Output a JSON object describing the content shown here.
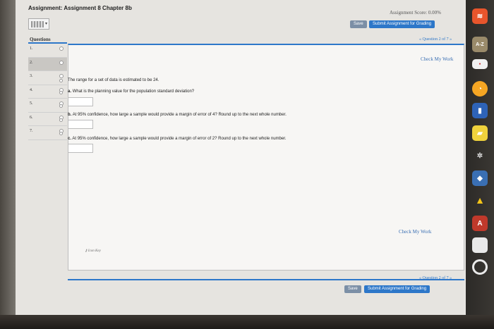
{
  "header": {
    "title": "Assignment: Assignment 8 Chapter 8b",
    "score": "Assignment Score: 0.00%"
  },
  "toolbar": {
    "save_label": "Save",
    "submit_label": "Submit Assignment for Grading"
  },
  "questions": {
    "header": "Questions",
    "items": [
      {
        "num": "1."
      },
      {
        "num": "2."
      },
      {
        "num": "3."
      },
      {
        "num": "4."
      },
      {
        "num": "5."
      },
      {
        "num": "6."
      },
      {
        "num": "7."
      }
    ],
    "active_index": 1
  },
  "nav": {
    "position": "« Question 2 of 7 »"
  },
  "main": {
    "check_work_label": "Check My Work",
    "intro": "The range for a set of data is estimated to be 24.",
    "parts": [
      {
        "label": "a.",
        "text": "What is the planning value for the population standard deviation?"
      },
      {
        "label": "b.",
        "text": "At 95% confidence, how large a sample would provide a margin of error of 4? Round up to the next whole number."
      },
      {
        "label": "c.",
        "text": "At 95% confidence, how large a sample would provide a margin of error of 2? Round up to the next whole number."
      }
    ],
    "icon_key_label": "Icon Key"
  },
  "dock": {
    "icons": [
      "feed-icon",
      "dictionary-icon",
      "web-app-icon",
      "clock-icon",
      "app-icon",
      "folder-icon",
      "gear-icon",
      "tool-icon",
      "drive-icon",
      "ebook-icon",
      "screen-icon",
      "circle-icon"
    ]
  }
}
